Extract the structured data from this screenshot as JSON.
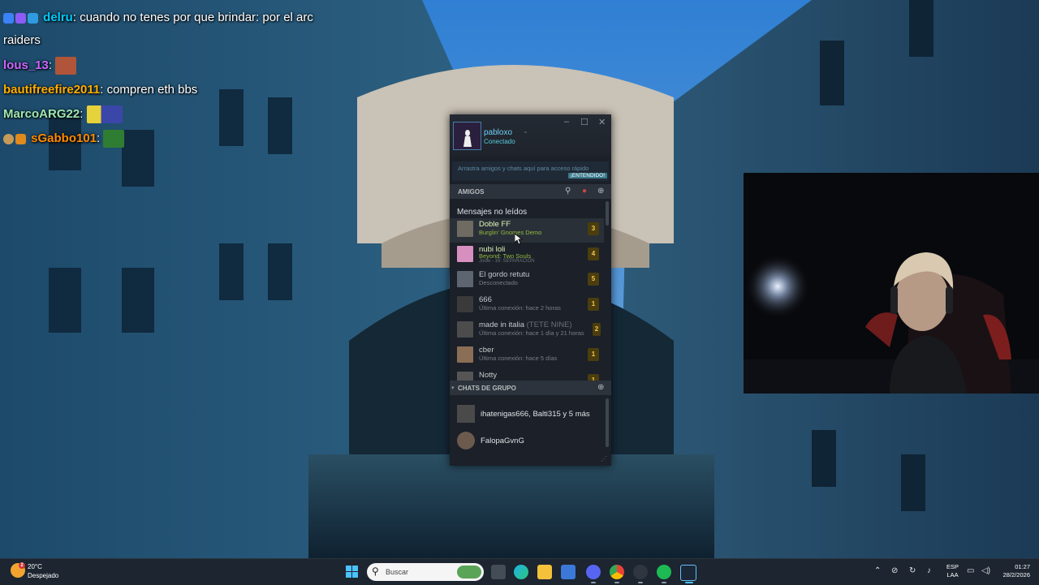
{
  "chat": {
    "messages": [
      {
        "user": "delru",
        "user_color": "#00ccff",
        "text": "cuando no tenes por que brindar: por el arc raiders"
      },
      {
        "user": "lous_13",
        "user_color": "#cc66ff",
        "text": ""
      },
      {
        "user": "bautifreefire2011",
        "user_color": "#ffae00",
        "text": "compren eth bbs"
      },
      {
        "user": "MarcoARG22",
        "user_color": "#9ee8b0",
        "text": ""
      },
      {
        "user": "sGabbo101",
        "user_color": "#ff8a00",
        "text": ""
      }
    ],
    "separator": ":"
  },
  "steam": {
    "username": "pabloxo",
    "status": "Conectado",
    "tip_text": "Arrastra amigos y chats aquí para acceso rápido",
    "tip_button": "¡ENTENDIDO!",
    "friends_label": "AMIGOS",
    "unread_label": "Mensajes no leídos",
    "friends": [
      {
        "name": "Doble FF",
        "sub": "Burglin' Gnomes Demo",
        "sub2": "",
        "count": "3",
        "state": "ingame"
      },
      {
        "name": "nubi loli",
        "sub": "Beyond: Two Souls",
        "sub2": "Jodie - 16: SEPARACIÓN",
        "count": "4",
        "state": "ingame"
      },
      {
        "name": "El gordo retutu",
        "sub": "Desconectado",
        "sub2": "",
        "count": "5",
        "state": "offline"
      },
      {
        "name": "666",
        "sub": "Última conexión: hace 2 horas",
        "sub2": "",
        "count": "1",
        "state": "offline"
      },
      {
        "name": "made in italia",
        "name_extra": "(TETE NINE)",
        "sub": "Última conexión: hace 1 día y 21 horas",
        "sub2": "",
        "count": "2",
        "state": "offline"
      },
      {
        "name": "cber",
        "sub": "Última conexión: hace 5 días",
        "sub2": "",
        "count": "1",
        "state": "offline"
      },
      {
        "name": "Notty",
        "sub": "",
        "sub2": "",
        "count": "1",
        "state": "offline"
      }
    ],
    "groups_label": "CHATS DE GRUPO",
    "groups": [
      {
        "name": "ihatenigas666, Balti315 y 5 más"
      },
      {
        "name": "FalopaGvnG"
      }
    ]
  },
  "taskbar": {
    "weather_badge": "2",
    "temperature": "20°C",
    "weather": "Despejado",
    "search_placeholder": "Buscar",
    "lang_line1": "ESP",
    "lang_line2": "LAA",
    "time": "01:27",
    "date": "28/2/2026"
  }
}
